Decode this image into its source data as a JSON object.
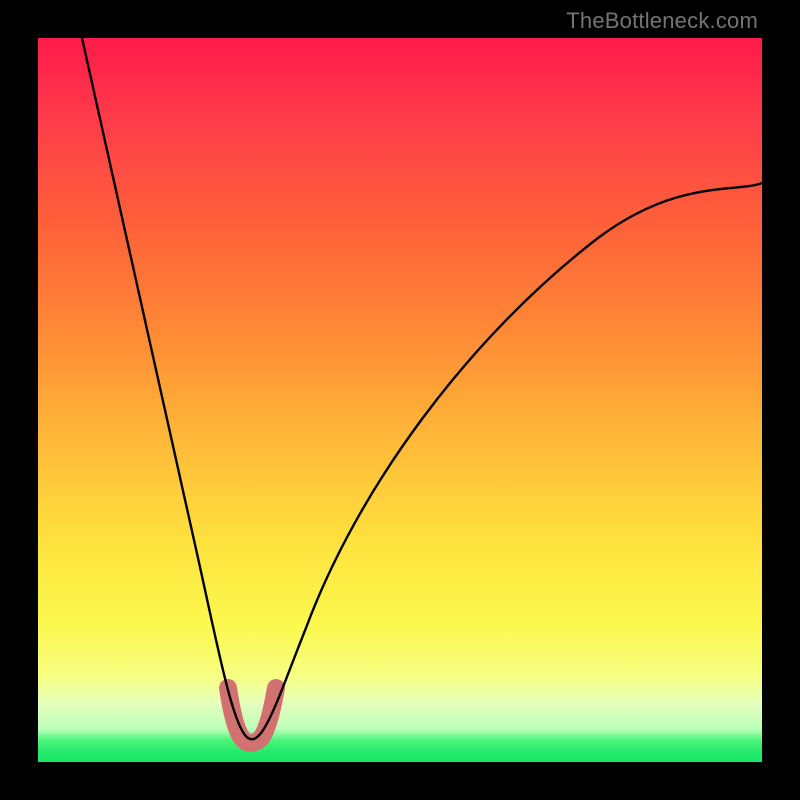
{
  "credit_text": "TheBottleneck.com",
  "chart_data": {
    "type": "line",
    "title": "",
    "xlabel": "",
    "ylabel": "",
    "xlim": [
      0,
      100
    ],
    "ylim": [
      0,
      100
    ],
    "series": [
      {
        "name": "curve",
        "x": [
          6,
          10,
          14,
          18,
          21,
          24,
          26.5,
          28,
          30,
          33,
          37,
          43,
          50,
          58,
          67,
          77,
          88,
          100
        ],
        "y": [
          100,
          84,
          67,
          50,
          35,
          20,
          10,
          4.5,
          3.5,
          7,
          16,
          28,
          40,
          50,
          59,
          67,
          74,
          80
        ]
      }
    ],
    "marker_band": {
      "name": "valley-marker",
      "color": "#d17270",
      "x_start": 26,
      "x_end": 33,
      "y_min": 3,
      "y_max": 11
    }
  }
}
